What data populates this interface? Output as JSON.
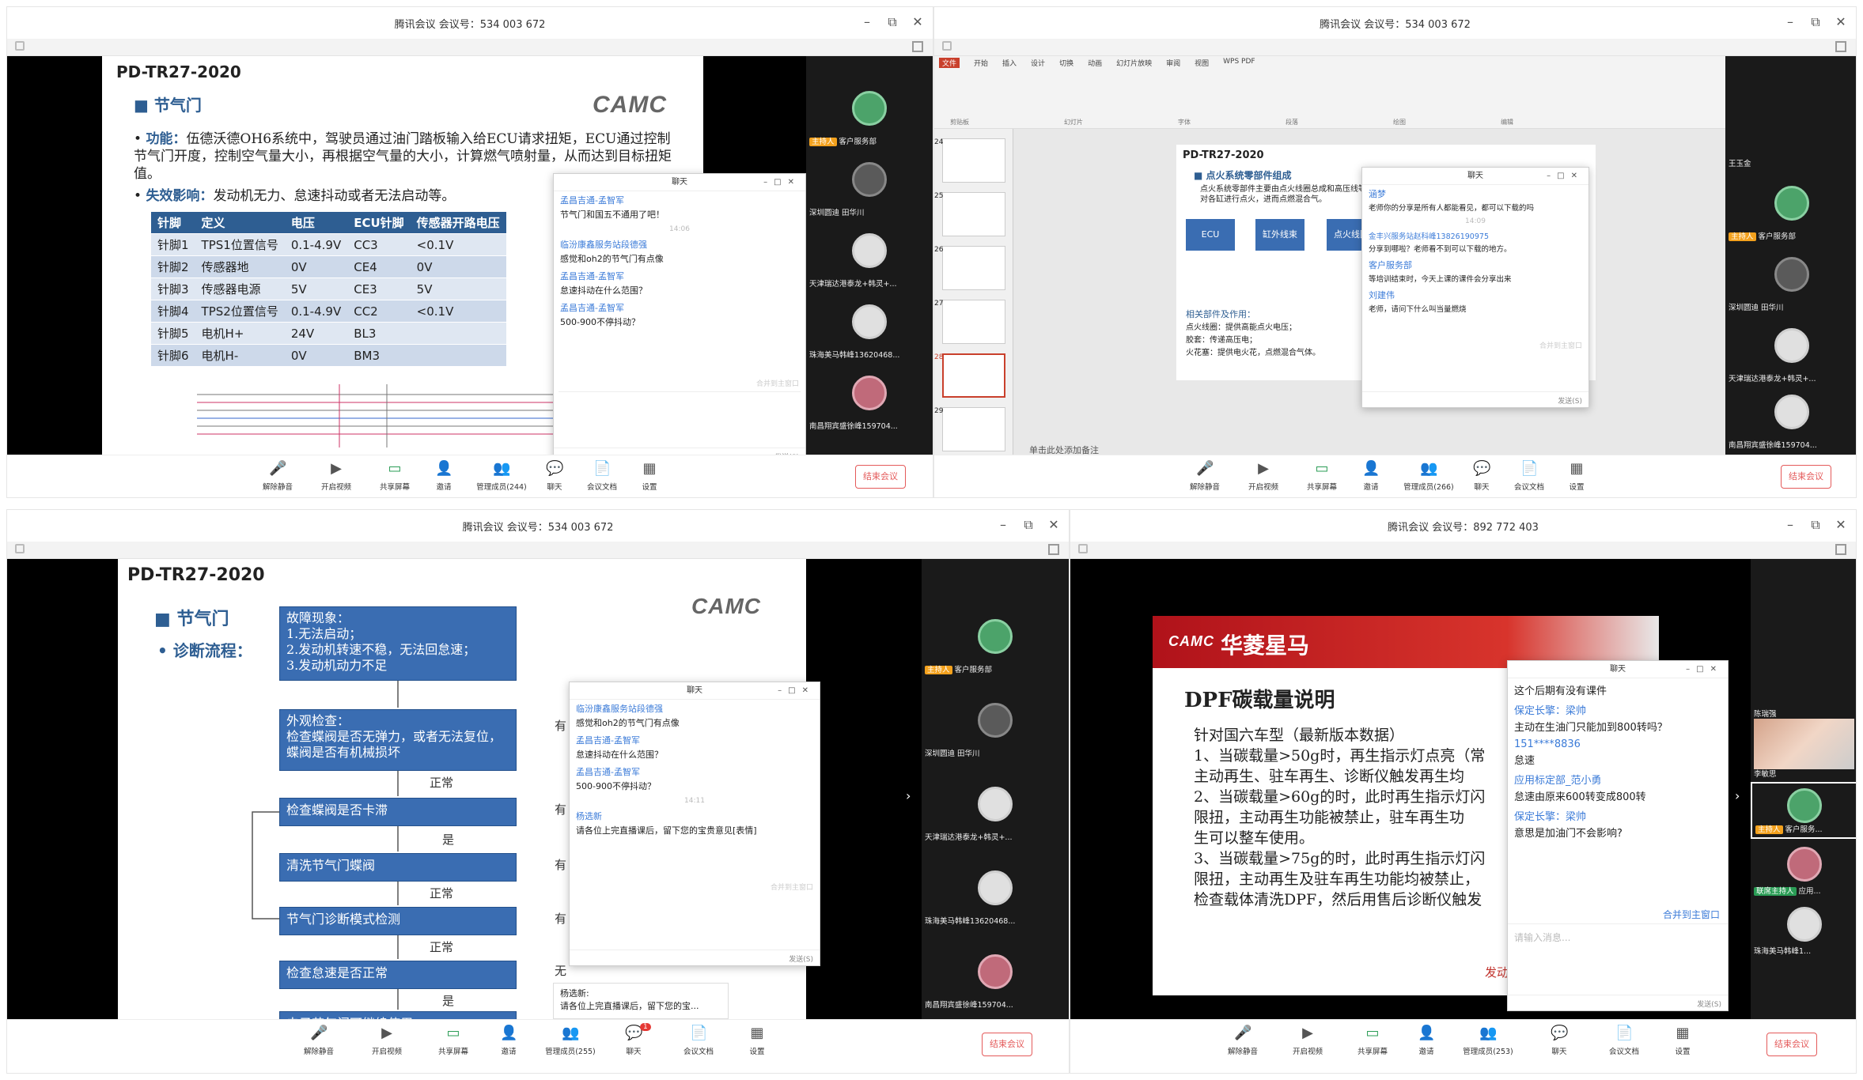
{
  "windows": [
    {
      "title": "腾讯会议 会议号：534 003 672"
    },
    {
      "title": "腾讯会议 会议号：534 003 672"
    },
    {
      "title": "腾讯会议 会议号：534 003 672"
    },
    {
      "title": "腾讯会议 会议号：892 772 403"
    }
  ],
  "window_controls": {
    "min": "–",
    "max": "⧉",
    "close": "✕"
  },
  "toolbar": {
    "unmute": "解除静音",
    "video": "开启视频",
    "share": "共享屏幕",
    "invite": "邀请",
    "members_244": "管理成员(244)",
    "members_266": "管理成员(266)",
    "members_255": "管理成员(255)",
    "members_253": "管理成员(253)",
    "chat": "聊天",
    "docs": "会议文档",
    "settings": "设置",
    "end": "结束会议",
    "chat_badge": "1"
  },
  "q1": {
    "doc_no": "PD-TR27-2020",
    "logo": "CAMC",
    "heading": "节气门",
    "func_label": "功能：",
    "func_text": "伍德沃德OH6系统中，驾驶员通过油门踏板输入给ECU请求扭矩，ECU通过控制节气门开度，控制空气量大小，再根据空气量的大小，计算燃气喷射量，从而达到目标扭矩值。",
    "fail_label": "失效影响：",
    "fail_text": "发动机无力、怠速抖动或者无法启动等。",
    "table": {
      "header": [
        "针脚",
        "定义",
        "电压",
        "ECU针脚",
        "传感器开路电压"
      ],
      "rows": [
        [
          "针脚1",
          "TPS1位置信号",
          "0.1-4.9V",
          "CC3",
          "<0.1V"
        ],
        [
          "针脚2",
          "传感器地",
          "0V",
          "CE4",
          "0V"
        ],
        [
          "针脚3",
          "传感器电源",
          "5V",
          "CE3",
          "5V"
        ],
        [
          "针脚4",
          "TPS2位置信号",
          "0.1-4.9V",
          "CC2",
          "<0.1V"
        ],
        [
          "针脚5",
          "电机H+",
          "24V",
          "BL3",
          ""
        ],
        [
          "针脚6",
          "电机H-",
          "0V",
          "BM3",
          ""
        ]
      ]
    },
    "chat": {
      "title": "聊天",
      "messages": [
        {
          "name": "孟昌吉通-孟智军",
          "text": "节气门和国五不通用了吧！"
        },
        {
          "time": "14:06"
        },
        {
          "name": "临汾康鑫服务站段德强",
          "text": "感觉和oh2的节气门有点像"
        },
        {
          "name": "孟昌吉通-孟智军",
          "text": "怠速抖动在什么范围？"
        },
        {
          "name": "孟昌吉通-孟智军",
          "text": "500-900不停抖动？"
        }
      ],
      "merge": "合并到主窗口",
      "send": "发送(S)"
    },
    "participants": [
      {
        "name": "客户服务部",
        "host": "主持人"
      },
      {
        "name": "深圳圆迪 田华川"
      },
      {
        "name": "天津瑞达港泰龙+韩灵+..."
      },
      {
        "name": "珠海美马韩峰13620468..."
      },
      {
        "name": "南昌翔宾盛徐峰159704..."
      }
    ]
  },
  "q2": {
    "ppt_tabs": [
      "文件",
      "开始",
      "插入",
      "设计",
      "切换",
      "动画",
      "幻灯片放映",
      "审阅",
      "视图",
      "WPS PDF"
    ],
    "ppt_groups": [
      "剪贴板",
      "幻灯片",
      "字体",
      "段落",
      "绘图",
      "编辑"
    ],
    "slide_numbers": [
      "24",
      "25",
      "26",
      "27",
      "28",
      "29"
    ],
    "doc_no": "PD-TR27-2020",
    "heading": "点火系统零部件组成",
    "desc": "点火系统零部件主要由点火线圈总成和高压线等组成，对各缸进行点火，进而点燃混合气。",
    "boxes": [
      "ECU",
      "缸外线束",
      "点火线圈"
    ],
    "parts_title": "相关部件及作用：",
    "parts": [
      "点火线圈：提供高能点火电压；",
      "胶套：传递高压电；",
      "火花塞：提供电火花，点燃混合气体。"
    ],
    "notes": "单击此处添加备注",
    "chat": {
      "title": "聊天",
      "messages": [
        {
          "name": "涵梦",
          "text": "老师你的分享是所有人都能看见，都可以下载的吗"
        },
        {
          "time": "14:09"
        },
        {
          "name": "金丰兴服务站赵科峰13826190975",
          "text": "分享到哪啦？老师看不到可以下载的地方。"
        },
        {
          "name": "客户服务部",
          "text": "等培训结束时，今天上课的课件会分享出来"
        },
        {
          "name": "刘建伟",
          "text": "老师，请问下什么叫当量燃烧"
        }
      ],
      "merge": "合并到主窗口",
      "send": "发送(S)"
    },
    "participants": [
      {
        "name": "王玉金"
      },
      {
        "name": "客户服务部",
        "host": "主持人"
      },
      {
        "name": "深圳圆迪 田华川"
      },
      {
        "name": "天津瑞达港泰龙+韩灵+..."
      },
      {
        "name": "南昌翔宾盛徐峰159704..."
      }
    ]
  },
  "q3": {
    "doc_no": "PD-TR27-2020",
    "logo": "CAMC",
    "heading": "节气门",
    "sub": "诊断流程：",
    "flow": [
      "故障现象：\n1.无法启动；\n2.发动机转速不稳，无法回怠速；\n3.发动机动力不足",
      "外观检查：\n检查蝶阀是否无弹力，或者无法复位，蝶阀是否有机械损坏",
      "检查蝶阀是否卡滞",
      "清洗节气门蝶阀",
      "节气门诊断模式检测",
      "检查怠速是否正常",
      "电子节气门可继续使用"
    ],
    "labels": [
      "正常",
      "是",
      "正常",
      "正常",
      "是"
    ],
    "side_labels": [
      "有",
      "有",
      "有",
      "有",
      "无"
    ],
    "chat": {
      "title": "聊天",
      "messages": [
        {
          "name": "临汾康鑫服务站段德强",
          "text": "感觉和oh2的节气门有点像"
        },
        {
          "name": "孟昌吉通-孟智军",
          "text": "怠速抖动在什么范围？"
        },
        {
          "name": "孟昌吉通-孟智军",
          "text": "500-900不停抖动？"
        },
        {
          "time": "14:11"
        },
        {
          "name": "杨选新",
          "text": "请各位上完直播课后，留下您的宝贵意见[表情]"
        }
      ],
      "merge": "合并到主窗口",
      "send": "发送(S)"
    },
    "toast": {
      "name": "杨选新:",
      "text": "请各位上完直播课后，留下您的宝..."
    },
    "participants": [
      {
        "name": "客户服务部",
        "host": "主持人"
      },
      {
        "name": "深圳圆迪 田华川"
      },
      {
        "name": "天津瑞达港泰龙+韩灵+..."
      },
      {
        "name": "珠海美马韩峰13620468..."
      },
      {
        "name": "南昌翔宾盛徐峰159704..."
      }
    ]
  },
  "q4": {
    "brand": "华菱星马",
    "logo": "CAMC",
    "heading": "DPF碳载量说明",
    "lines": [
      "针对国六车型（最新版本数据）",
      "1、当碳载量>50g时，再生指示灯点亮（常",
      "主动再生、驻车再生、诊断仪触发再生均",
      "2、当碳载量>60g的时，此时再生指示灯闪",
      "限扭，主动再生功能被禁止，驻车再生功",
      "生可以整车使用。",
      "3、当碳载量>75g的时，此时再生指示灯闪",
      "限扭，主动再生及驻车再生功能均被禁止，",
      "检查载体清洗DPF，然后用售后诊断仪触发"
    ],
    "footer": "发动",
    "chat": {
      "title": "聊天",
      "messages": [
        {
          "text": "这个后期有没有课件"
        },
        {
          "name": "保定长擎：梁帅",
          "text": "主动在生油门只能加到800转吗？"
        },
        {
          "name": "151****8836",
          "text": "怠速"
        },
        {
          "name": "应用标定部_范小勇",
          "text": "怠速由原来600转变成800转"
        },
        {
          "name": "保定长擎：梁帅",
          "text": "意思是加油门不会影响?"
        }
      ],
      "merge": "合并到主窗口",
      "placeholder": "请输入消息...",
      "send": "发送(S)"
    },
    "participants": [
      {
        "name": "陈瑞强"
      },
      {
        "name": "李敏思"
      },
      {
        "name": "客户服务...",
        "host": "主持人"
      },
      {
        "name": "应用...",
        "host": "联席主持人"
      },
      {
        "name": "珠海美马韩峰1..."
      }
    ]
  }
}
